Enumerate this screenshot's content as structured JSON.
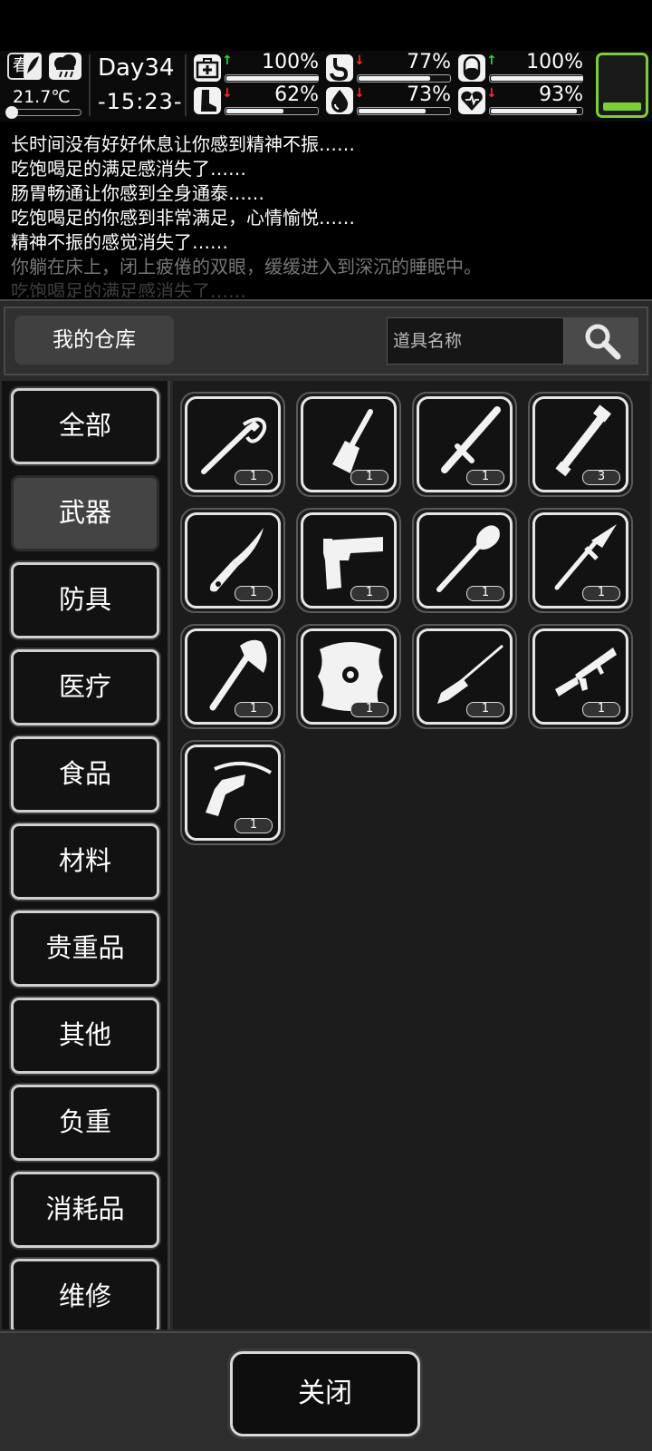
{
  "status": {
    "season": "春",
    "temperature": "21.7℃",
    "day": "Day34",
    "time": "-15:23-",
    "stats": [
      {
        "name": "health",
        "icon": "medkit-icon",
        "arrow": "up",
        "percent": "100%",
        "level": 1.0
      },
      {
        "name": "hunger",
        "icon": "stomach-icon",
        "arrow": "down",
        "percent": "77%",
        "level": 0.77
      },
      {
        "name": "sanity",
        "icon": "pill-icon",
        "arrow": "up",
        "percent": "100%",
        "level": 1.0
      },
      {
        "name": "stamina",
        "icon": "boot-icon",
        "arrow": "down",
        "percent": "62%",
        "level": 0.62
      },
      {
        "name": "thirst",
        "icon": "water-drop-icon",
        "arrow": "down",
        "percent": "73%",
        "level": 0.73
      },
      {
        "name": "mood",
        "icon": "heart-icon",
        "arrow": "down",
        "percent": "93%",
        "level": 0.93
      }
    ],
    "battery_level": 0.15,
    "colors": {
      "battery": "#7ccd36",
      "arrow_up": "#28e028",
      "arrow_down": "#ff2a2a"
    }
  },
  "log": [
    "长时间没有好好休息让你感到精神不振……",
    "吃饱喝足的满足感消失了……",
    "肠胃畅通让你感到全身通泰……",
    "吃饱喝足的你感到非常满足，心情愉悦……",
    "精神不振的感觉消失了……",
    "你躺在床上，闭上疲倦的双眼，缓缓进入到深沉的睡眠中。",
    "吃饱喝足的满足感消失了……"
  ],
  "warehouse": {
    "title": "我的仓库",
    "search_placeholder": "道具名称",
    "categories": [
      "全部",
      "武器",
      "防具",
      "医疗",
      "食品",
      "材料",
      "贵重品",
      "其他",
      "负重",
      "消耗品",
      "维修"
    ],
    "active_category": "武器",
    "items": [
      {
        "icon": "sabre-icon",
        "count": "1"
      },
      {
        "icon": "shovel-blade-icon",
        "count": "1"
      },
      {
        "icon": "baton-icon",
        "count": "1"
      },
      {
        "icon": "pipe-icon",
        "count": "3"
      },
      {
        "icon": "folding-knife-icon",
        "count": "1"
      },
      {
        "icon": "pistol-icon",
        "count": "1"
      },
      {
        "icon": "shovel-icon",
        "count": "1"
      },
      {
        "icon": "spear-icon",
        "count": "1"
      },
      {
        "icon": "axe-icon",
        "count": "1"
      },
      {
        "icon": "shield-icon",
        "count": "1"
      },
      {
        "icon": "rifle-icon",
        "count": "1"
      },
      {
        "icon": "submachine-gun-icon",
        "count": "1"
      },
      {
        "icon": "crossbow-icon",
        "count": "1"
      }
    ]
  },
  "close_label": "关闭"
}
